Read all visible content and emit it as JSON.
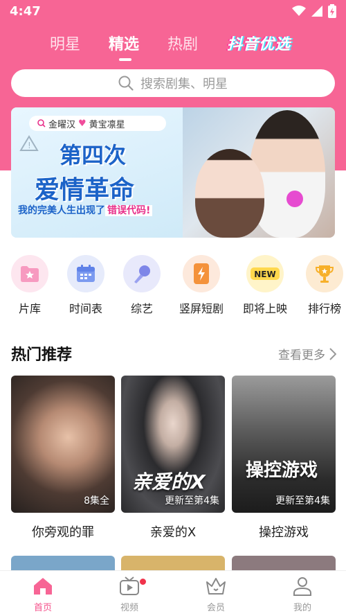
{
  "status_bar": {
    "time": "4:47"
  },
  "top_tabs": [
    {
      "label": "明星"
    },
    {
      "label": "精选",
      "active": true
    },
    {
      "label": "热剧"
    },
    {
      "label": "抖音优选"
    }
  ],
  "search": {
    "placeholder": "搜索剧集、明星"
  },
  "banner": {
    "cast_a": "金曜汉",
    "cast_b": "黄宝凛星",
    "title_line1": "第四次",
    "title_line2": "爱情革命",
    "subtitle": "我的完美人生出现了",
    "subtitle_highlight": "错误代码!"
  },
  "categories": [
    {
      "label": "片库",
      "icon": "star-folder-icon",
      "bg": "#fde6ef"
    },
    {
      "label": "时间表",
      "icon": "calendar-icon",
      "bg": "#e6ebfb"
    },
    {
      "label": "综艺",
      "icon": "microphone-icon",
      "bg": "#e8e9fb"
    },
    {
      "label": "竖屏短剧",
      "icon": "phone-lightning-icon",
      "bg": "#fde9dc"
    },
    {
      "label": "即将上映",
      "icon": "new-badge-icon",
      "bg": "#fff4c9"
    },
    {
      "label": "排行榜",
      "icon": "trophy-icon",
      "bg": "#fdebd2"
    }
  ],
  "section": {
    "title": "热门推荐",
    "more": "查看更多"
  },
  "cards": [
    {
      "name": "你旁观的罪",
      "badge": "8集全",
      "poster_title": ""
    },
    {
      "name": "亲爱的X",
      "badge": "更新至第4集",
      "poster_title": "亲爱的X"
    },
    {
      "name": "操控游戏",
      "badge": "更新至第4集",
      "poster_title": "操控游戏"
    }
  ],
  "bottom_nav": [
    {
      "label": "首页",
      "icon": "home-icon",
      "active": true
    },
    {
      "label": "视频",
      "icon": "video-icon",
      "dot": true
    },
    {
      "label": "会员",
      "icon": "crown-icon"
    },
    {
      "label": "我的",
      "icon": "user-icon"
    }
  ],
  "colors": {
    "brand_pink": "#f76595",
    "accent": "#f5508a"
  }
}
